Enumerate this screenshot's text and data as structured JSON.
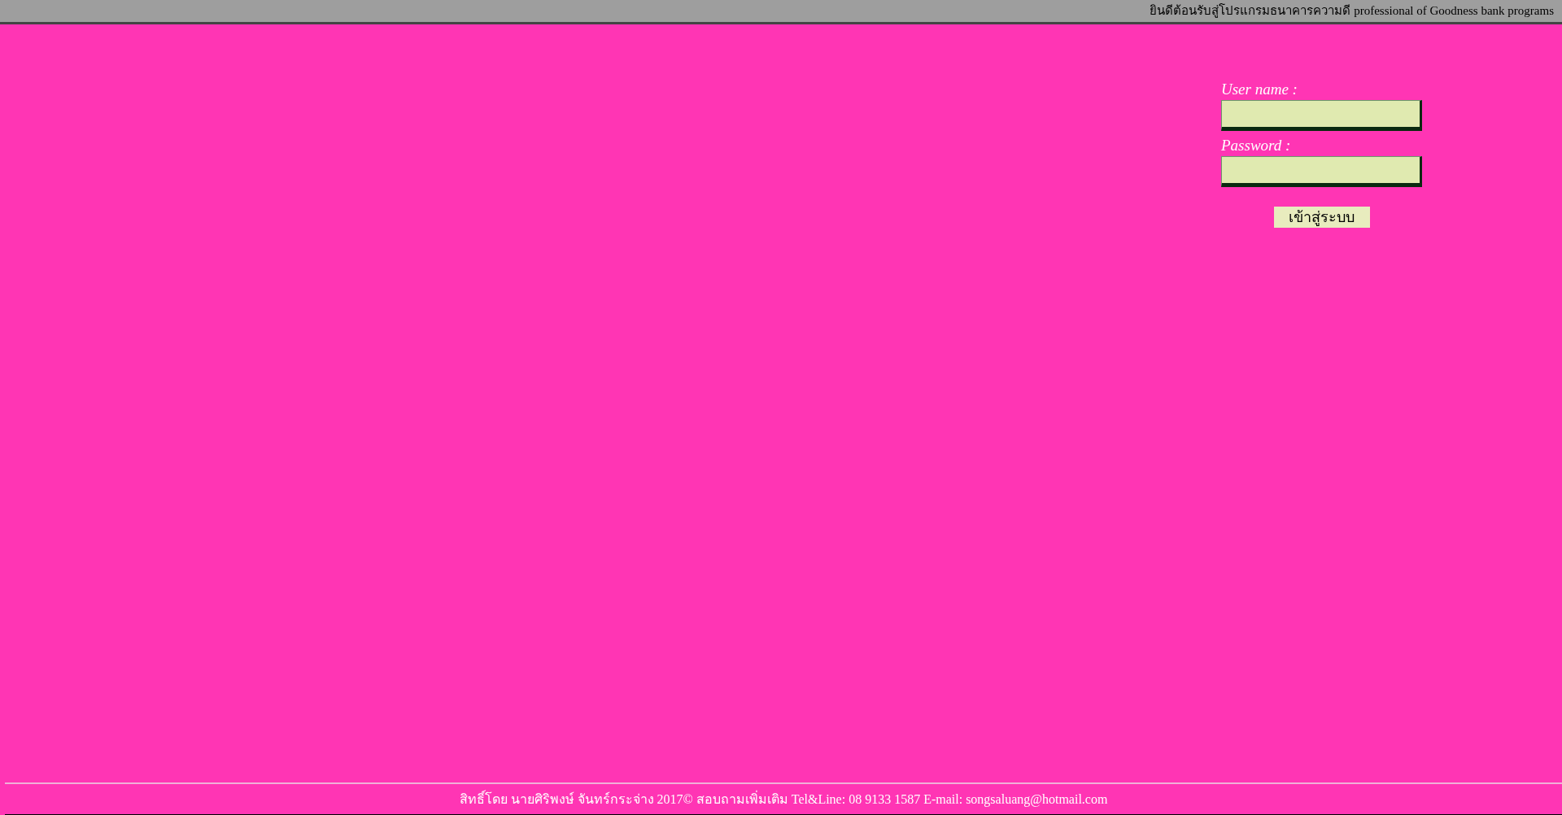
{
  "header": {
    "welcome": "ยินดีต้อนรับสู่โปรแกรมธนาคารความดี professional of Goodness bank programs"
  },
  "login": {
    "username_label": "User name :",
    "password_label": "Password :",
    "submit": "เข้าสู่ระบบ"
  },
  "footer": {
    "text": "สิทธิ์โดย นายศิริพงษ์ จันทร์กระจ่าง 2017© สอบถามเพิ่มเติม Tel&Line: 08 9133 1587 E-mail: songsaluang@hotmail.com"
  }
}
